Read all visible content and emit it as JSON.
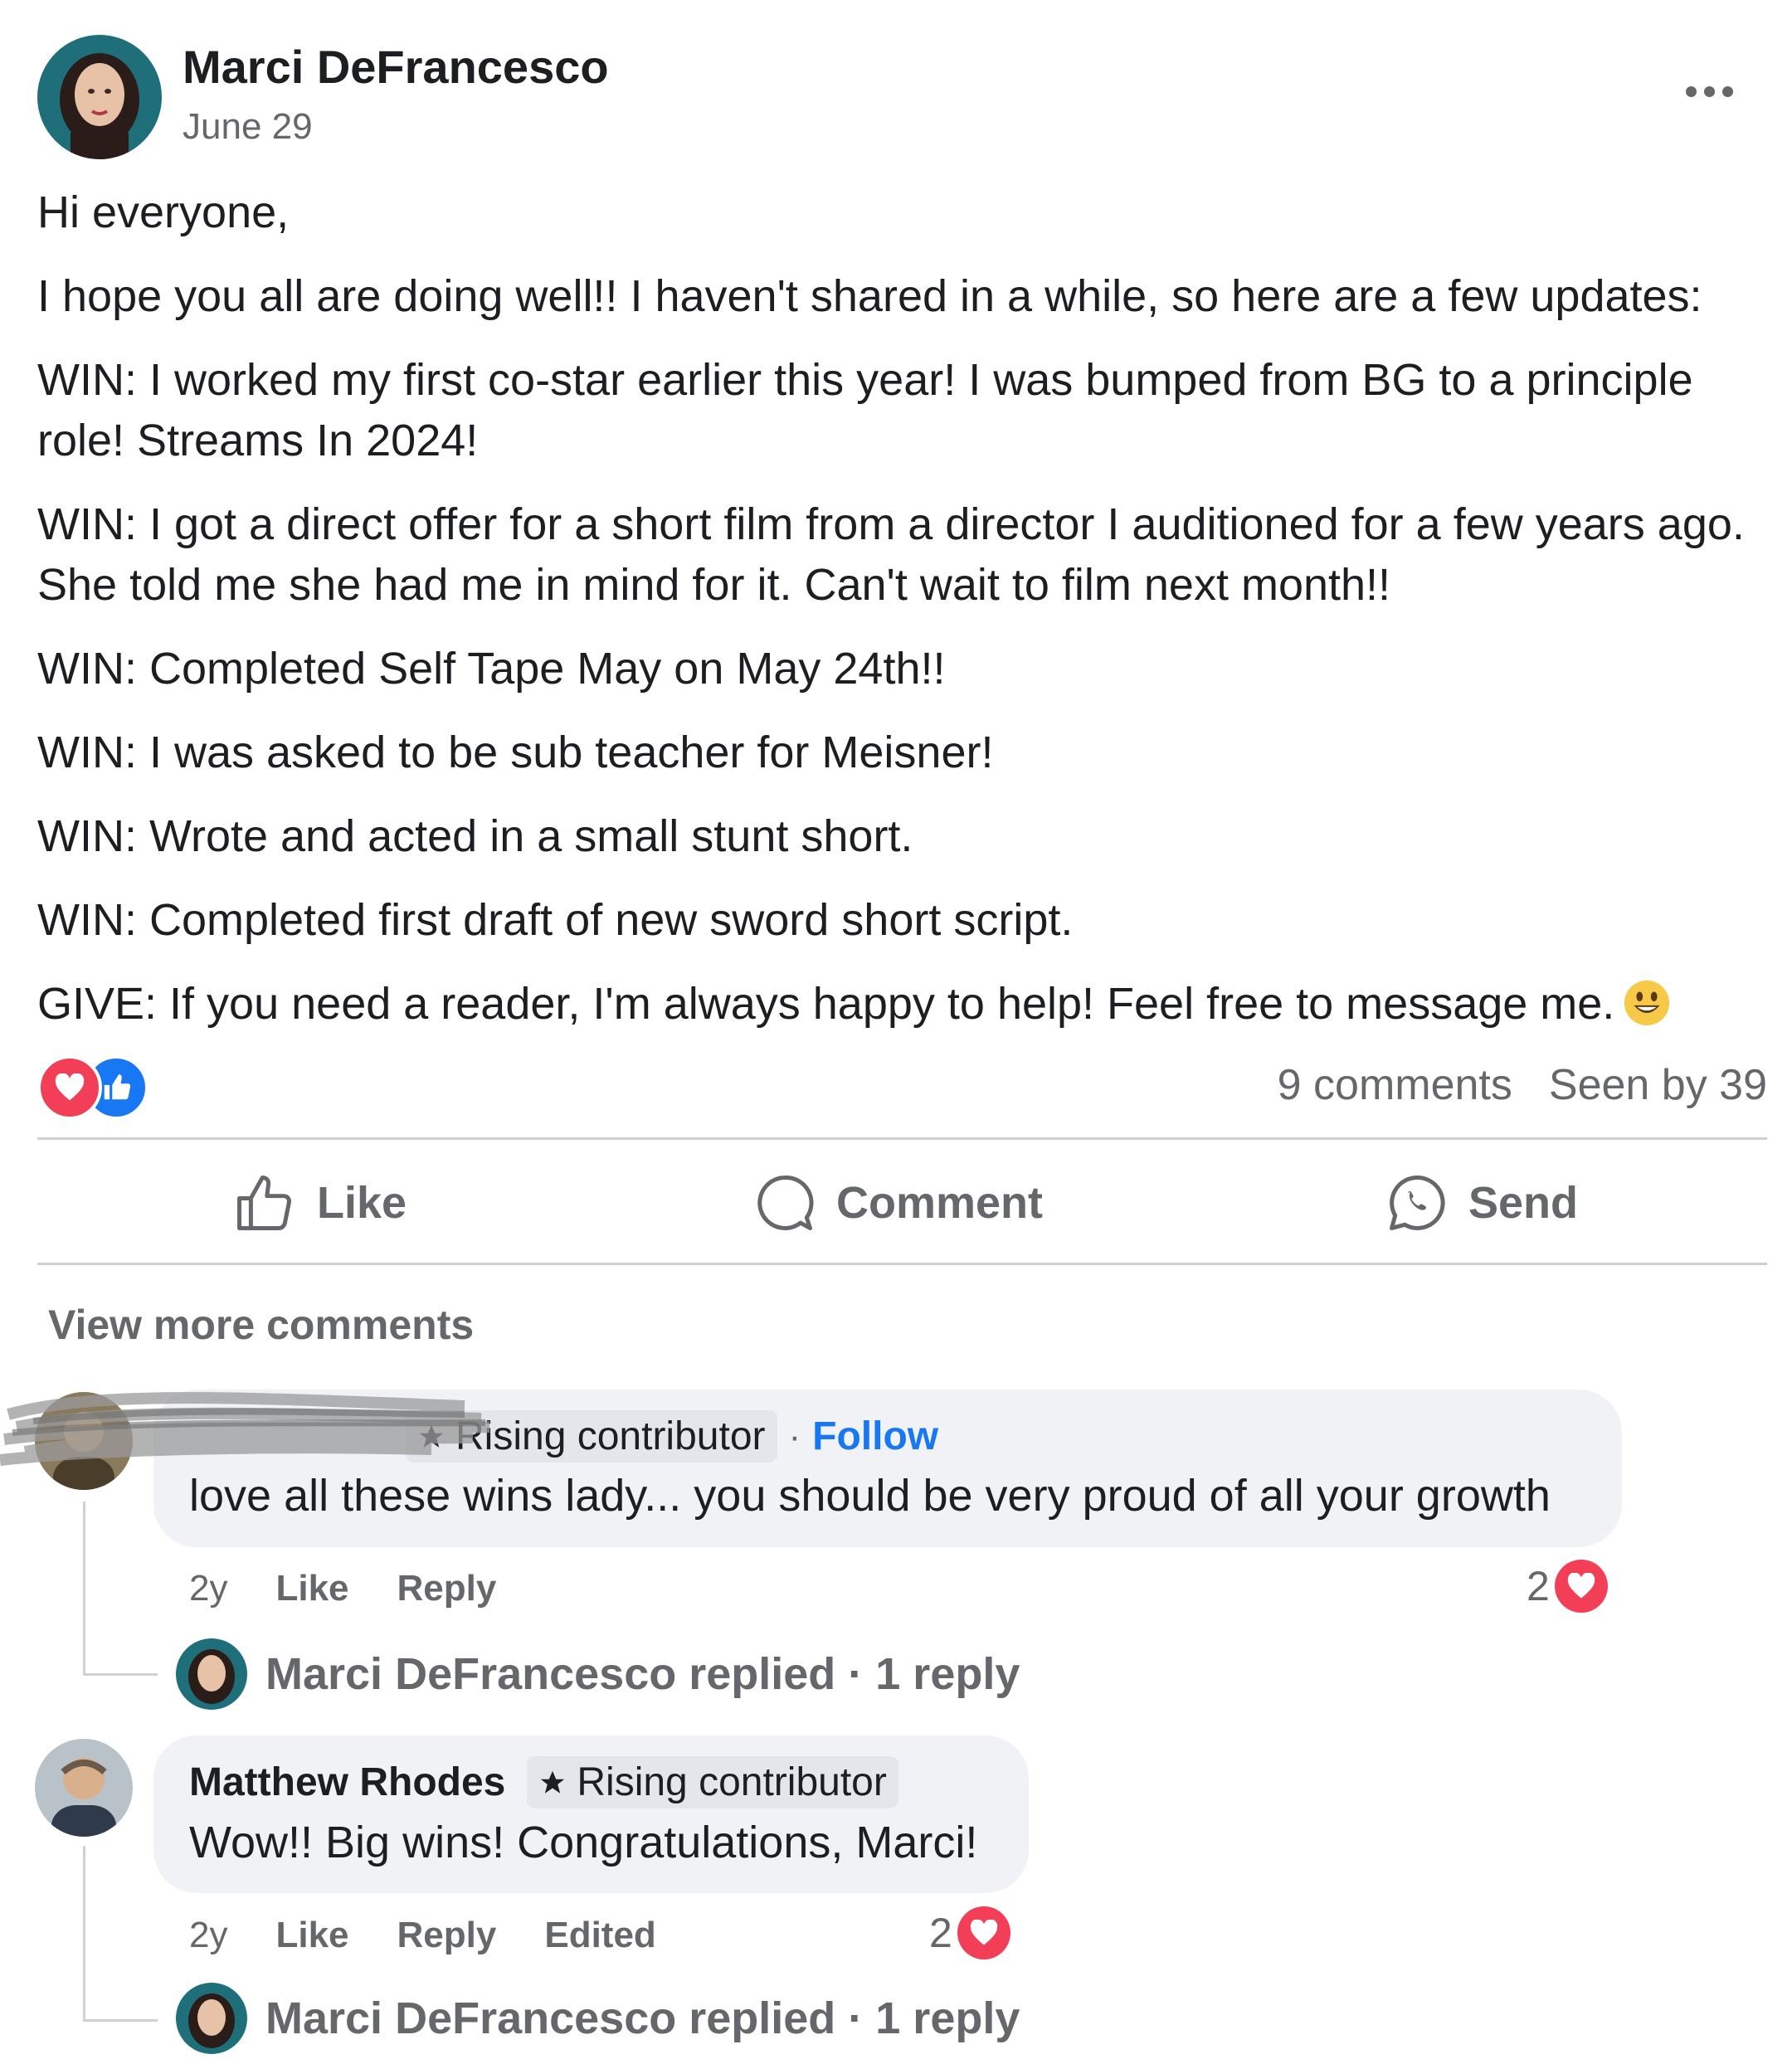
{
  "post": {
    "author": "Marci DeFrancesco",
    "date": "June 29",
    "paragraphs": [
      "Hi everyone,",
      "I hope you all are doing well!! I haven't shared in a while, so here are a few updates:",
      "WIN: I worked my first co-star earlier this year! I was bumped from BG to a principle role! Streams In 2024!",
      "WIN: I got a direct offer for a short film from a director I auditioned for a few years ago. She told me she had me in mind for it. Can't wait to film next month!!",
      "WIN: Completed Self Tape May on May 24th!!",
      "WIN: I was asked to be sub teacher for Meisner!",
      "WIN: Wrote and acted in a small stunt short.",
      "WIN: Completed first draft of new sword short script.",
      "GIVE: If you need a reader, I'm always happy to help! Feel free to message me."
    ],
    "emoji": "smiley-emoji",
    "reactions": [
      "love",
      "like"
    ],
    "comments_count": "9 comments",
    "seen_by": "Seen by 39"
  },
  "actions": {
    "like": "Like",
    "comment": "Comment",
    "send": "Send"
  },
  "view_more": "View more comments",
  "comments": [
    {
      "name": "",
      "badge": "Rising contributor",
      "follow": "Follow",
      "follow_sep": "·",
      "text": "love all these wins lady... you should be very proud of all your growth",
      "time": "2y",
      "like": "Like",
      "reply": "Reply",
      "reaction_count": "2",
      "replied": "Marci DeFrancesco replied · 1 reply"
    },
    {
      "name": "Matthew Rhodes",
      "badge": "Rising contributor",
      "text": "Wow!! Big wins! Congratulations, Marci!",
      "time": "2y",
      "like": "Like",
      "reply": "Reply",
      "edited": "Edited",
      "reaction_count": "2",
      "replied": "Marci DeFrancesco replied · 1 reply"
    }
  ],
  "colors": {
    "accent": "#1877f2",
    "love": "#f33e58",
    "secondary_text": "#65676b",
    "bubble": "#f0f2f5"
  }
}
